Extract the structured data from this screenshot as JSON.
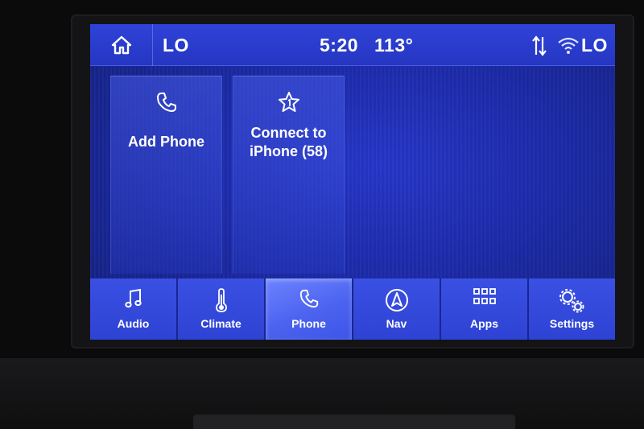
{
  "status_bar": {
    "home_icon": "home-icon",
    "left_label": "LO",
    "time": "5:20",
    "temperature": "113°",
    "signal_icon": "data-arrows-icon",
    "wifi_icon": "wifi-icon",
    "right_label": "LO"
  },
  "tiles": [
    {
      "label": "Add Phone",
      "icon": "phone-icon"
    },
    {
      "label_line1": "Connect to",
      "label_line2": "iPhone (58)",
      "icon": "star-favorite-icon"
    }
  ],
  "nav": {
    "active": "Phone",
    "items": [
      {
        "label": "Audio",
        "icon": "music-note-icon"
      },
      {
        "label": "Climate",
        "icon": "thermometer-icon"
      },
      {
        "label": "Phone",
        "icon": "phone-icon"
      },
      {
        "label": "Nav",
        "icon": "navigation-arrow-icon"
      },
      {
        "label": "Apps",
        "icon": "apps-grid-icon"
      },
      {
        "label": "Settings",
        "icon": "gears-icon"
      }
    ]
  },
  "colors": {
    "screen_bg": "#1c2aa8",
    "topbar_bg": "#2f43d8",
    "nav_bg": "#3a50e3",
    "nav_active": "#5a70f5",
    "text": "#ffffff"
  }
}
